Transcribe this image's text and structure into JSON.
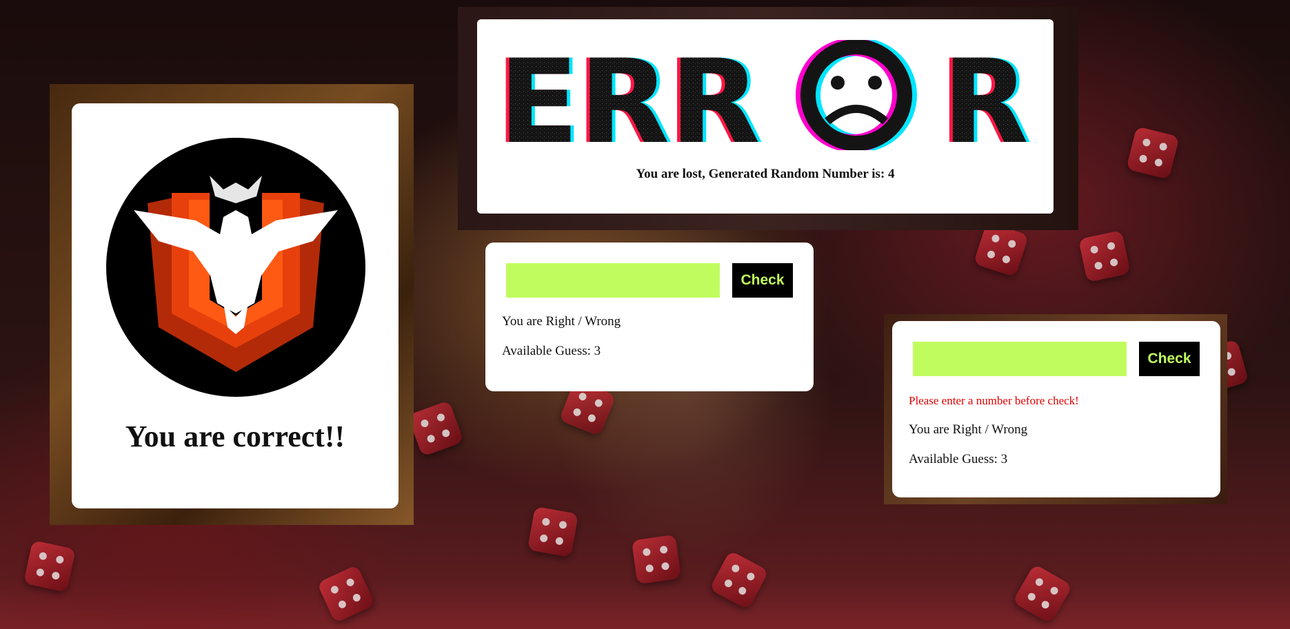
{
  "success_card": {
    "message": "You are correct!!",
    "badge_icon": "eagle-emblem-icon",
    "badge_colors": {
      "circle": "#000000",
      "shield": "#e8400c",
      "eagle": "#ffffff"
    }
  },
  "error_card": {
    "error_word": "ERROR",
    "error_icon": "sad-face-icon",
    "message": "You are lost, Generated Random Number is: 4"
  },
  "guess_card_1": {
    "input_value": "",
    "check_label": "Check",
    "result_text": "You are Right / Wrong",
    "available_guess": "Available Guess: 3"
  },
  "guess_card_2": {
    "input_value": "",
    "check_label": "Check",
    "warning_text": "Please enter a number before check!",
    "result_text": "You are Right / Wrong",
    "available_guess": "Available Guess: 3"
  },
  "colors": {
    "input_bg": "#c1fc5f",
    "button_bg": "#000000",
    "button_text": "#c1fc5f",
    "warning": "#e00000"
  }
}
